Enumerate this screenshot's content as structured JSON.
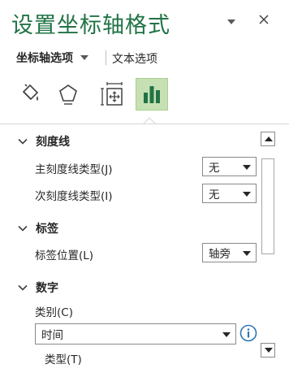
{
  "pane": {
    "title": "设置坐标轴格式",
    "dropdown_icon": "triangle-down-icon",
    "close_icon": "close-icon"
  },
  "tabs": {
    "axis_options": "坐标轴选项",
    "text_options": "文本选项"
  },
  "icon_tabs": [
    "fill-line-icon",
    "effects-icon",
    "size-properties-icon",
    "axis-options-icon"
  ],
  "sections": {
    "tick_marks": {
      "title": "刻度线",
      "major_label": "主刻度线类型(J)",
      "major_value": "无",
      "minor_label": "次刻度线类型(I)",
      "minor_value": "无"
    },
    "labels": {
      "title": "标签",
      "position_label": "标签位置(L)",
      "position_value": "轴旁"
    },
    "number": {
      "title": "数字",
      "category_label": "类别(C)",
      "category_value": "时间",
      "type_label": "类型(T)"
    }
  },
  "colors": {
    "accent": "#217346",
    "selected_tab_bg": "#c6e0b4"
  }
}
